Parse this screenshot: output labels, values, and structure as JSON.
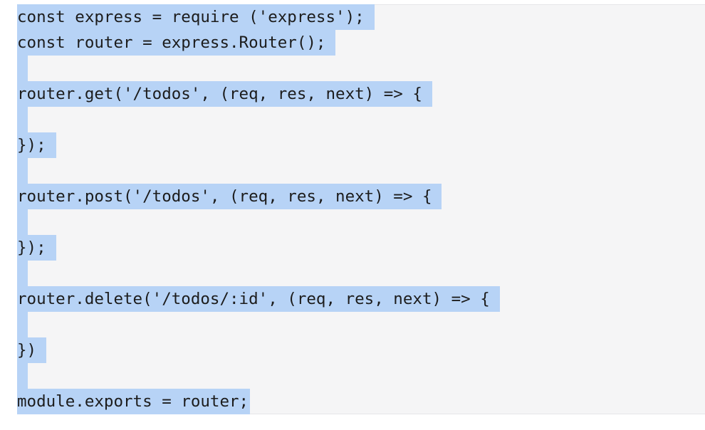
{
  "editor": {
    "language": "javascript",
    "selection_color": "#b7d3f6",
    "background_color": "#f5f5f6",
    "lines": [
      "const express = require ('express');",
      "const router = express.Router();",
      "",
      "router.get('/todos', (req, res, next) => {",
      "",
      "});",
      "",
      "router.post('/todos', (req, res, next) => {",
      "",
      "});",
      "",
      "router.delete('/todos/:id', (req, res, next) => {",
      "",
      "})",
      "",
      "module.exports = router;"
    ]
  }
}
